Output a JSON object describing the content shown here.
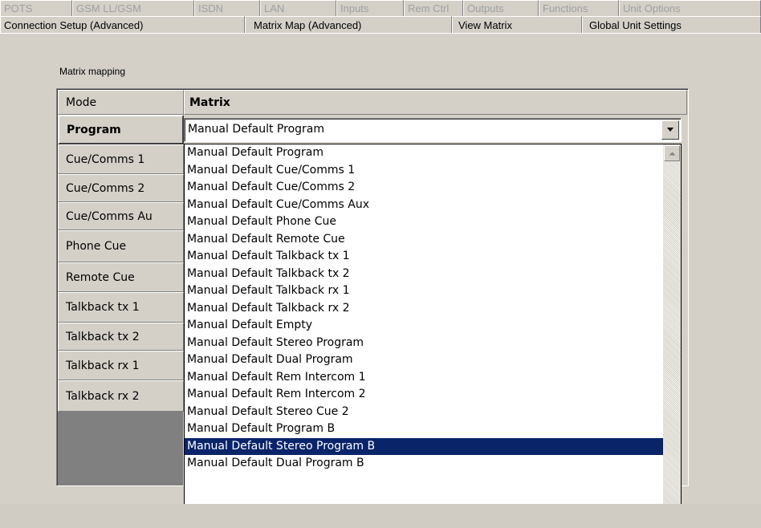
{
  "tabs_row1": [
    "POTS",
    "GSM LL/GSM",
    "ISDN",
    "LAN",
    "Inputs",
    "Rem Ctrl",
    "Outputs",
    "Functions",
    "Unit Options"
  ],
  "tabs_row2": [
    "Connection Setup (Advanced)",
    "Matrix Map (Advanced)",
    "View Matrix",
    "Global Unit Settings"
  ],
  "active_tab": "Matrix Map (Advanced)",
  "group_label": "Matrix mapping",
  "table": {
    "header_mode": "Mode",
    "header_matrix": "Matrix",
    "rows": [
      "Program",
      "Cue/Comms 1",
      "Cue/Comms 2",
      "Cue/Comms Au",
      "Phone Cue",
      "Remote Cue",
      "Talkback tx 1",
      "Talkback tx 2",
      "Talkback rx 1",
      "Talkback rx 2"
    ]
  },
  "combo": {
    "value": "Manual Default Program",
    "arrow_icon": "chevron-down-icon"
  },
  "dropdown": {
    "selected": "Manual Default Stereo Program B",
    "options": [
      "Manual Default Program",
      "Manual Default Cue/Comms 1",
      "Manual Default Cue/Comms 2",
      "Manual Default Cue/Comms Aux",
      "Manual Default Phone Cue",
      "Manual Default Remote Cue",
      "Manual Default Talkback tx 1",
      "Manual Default Talkback tx 2",
      "Manual Default Talkback rx 1",
      "Manual Default Talkback rx 2",
      "Manual Default Empty",
      "Manual Default Stereo Program",
      "Manual Default Dual Program",
      "Manual Default Rem Intercom 1",
      "Manual Default Rem Intercom 2",
      "Manual Default Stereo Cue 2",
      "Manual Default Program B",
      "Manual Default Stereo Program B",
      "Manual Default Dual Program B"
    ]
  },
  "colors": {
    "window_bg": "#d4d0c8",
    "selection_bg": "#0a246a",
    "disabled_text": "#a0a0a0"
  }
}
